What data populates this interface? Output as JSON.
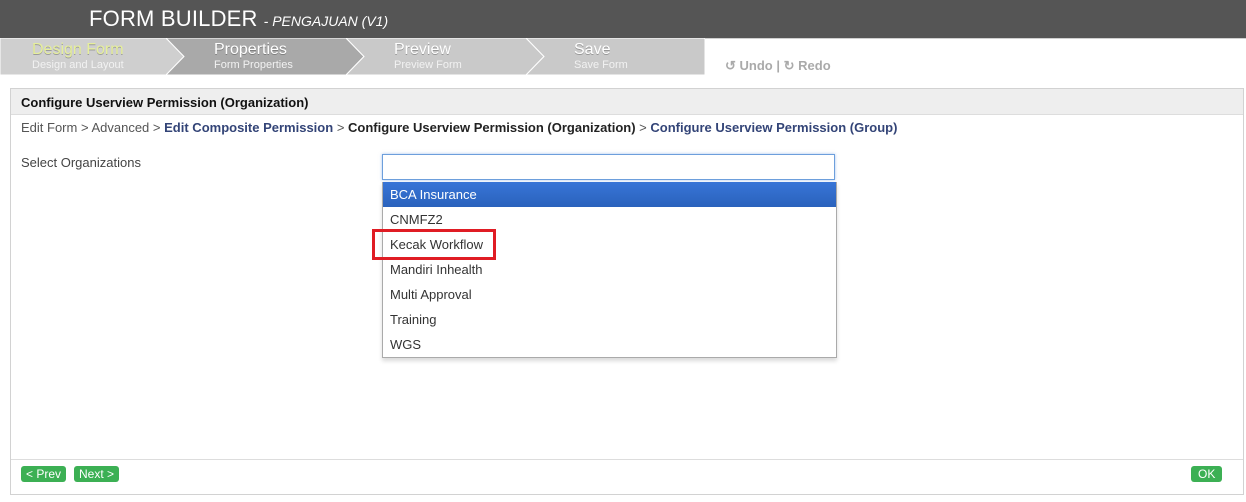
{
  "app": {
    "title": "FORM BUILDER",
    "subtitle": "- PENGAJUAN (V1)"
  },
  "steps": [
    {
      "label": "Design Form",
      "sub": "Design and Layout",
      "state": "done"
    },
    {
      "label": "Properties",
      "sub": "Form Properties",
      "state": "active"
    },
    {
      "label": "Preview",
      "sub": "Preview Form",
      "state": "pending"
    },
    {
      "label": "Save",
      "sub": "Save Form",
      "state": "pending"
    }
  ],
  "toolbar": {
    "undo_label": "Undo",
    "separator": "|",
    "redo_label": "Redo",
    "undo_icon": "undo-icon",
    "redo_icon": "redo-icon"
  },
  "panel": {
    "title": "Configure Userview Permission (Organization)"
  },
  "breadcrumb": {
    "items": [
      "Edit Form",
      "Advanced",
      "Edit Composite Permission",
      "Configure Userview Permission (Organization)",
      "Configure Userview Permission (Group)"
    ],
    "separator": ">"
  },
  "form": {
    "field_label": "Select Organizations",
    "search_value": "",
    "options": [
      "BCA Insurance",
      "CNMFZ2",
      "Kecak Workflow",
      "Mandiri Inhealth",
      "Multi Approval",
      "Training",
      "WGS"
    ]
  },
  "footer": {
    "prev_label": "< Prev",
    "next_label": "Next >",
    "ok_label": "OK"
  },
  "colors": {
    "topbar": "#555555",
    "step_done_text": "#e6ef9c",
    "step_active_bg": "#aaaaaa",
    "step_pending_bg": "#c8c8c8",
    "button_green": "#3cb054",
    "dropdown_active": "#3875d7",
    "highlight_red": "#e01c24"
  }
}
